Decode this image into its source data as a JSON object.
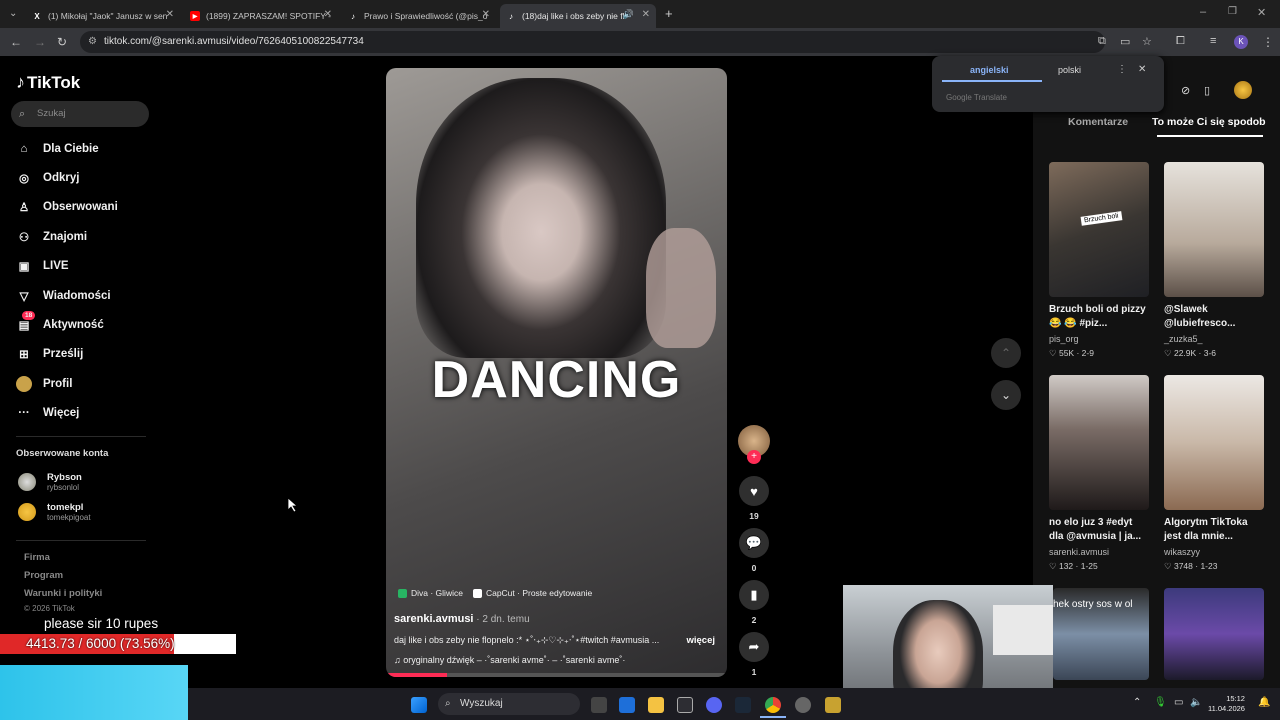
{
  "browser": {
    "tabs": [
      {
        "title": "(1) Mikołaj \"Jaok\" Janusz w sen",
        "icon": "x-icon"
      },
      {
        "title": "(1899) ZAPRASZAM! SPOTIFY -",
        "icon": "youtube-icon"
      },
      {
        "title": "Prawo i Sprawiedliwość (@pis_o",
        "icon": "tiktok-icon"
      },
      {
        "title": "(18)daj like i obs zeby nie fl",
        "icon": "tiktok-icon"
      }
    ],
    "url": "tiktok.com/@sarenki.avmusi/video/7626405100822547734"
  },
  "translate_popup": {
    "lang_from": "angielski",
    "lang_to": "polski",
    "footer": "Google Translate"
  },
  "sidebar": {
    "logo": "TikTok",
    "search_placeholder": "Szukaj",
    "nav": [
      {
        "label": "Dla Ciebie",
        "icon": "home-icon"
      },
      {
        "label": "Odkryj",
        "icon": "compass-icon"
      },
      {
        "label": "Obserwowani",
        "icon": "following-icon"
      },
      {
        "label": "Znajomi",
        "icon": "friends-icon"
      },
      {
        "label": "LIVE",
        "icon": "live-icon"
      },
      {
        "label": "Wiadomości",
        "icon": "messages-icon"
      },
      {
        "label": "Aktywność",
        "icon": "activity-icon",
        "badge": "18"
      },
      {
        "label": "Prześlij",
        "icon": "upload-icon"
      },
      {
        "label": "Profil",
        "icon": "profile-icon"
      },
      {
        "label": "Więcej",
        "icon": "more-icon"
      }
    ],
    "followed_header": "Obserwowane konta",
    "followed": [
      {
        "name": "Rybson",
        "handle": "rybsonlol"
      },
      {
        "name": "tomekpl",
        "handle": "tomekpigoat"
      }
    ],
    "footer": [
      "Firma",
      "Program",
      "Warunki i polityki"
    ],
    "copyright": "© 2026 TikTok"
  },
  "video": {
    "overlay_word": "DANCING",
    "chips": [
      "Diva · Gliwice",
      "CapCut · Proste edytowanie"
    ],
    "author": "sarenki.avmusi",
    "ago": " · 2 dn. temu",
    "description": "daj like i obs zeby nie flopnelo :* ⋆˚‧₊⊹♡⊹₊‧˚⋆#twitch #avmusia ...",
    "more": "więcej",
    "sound": "♫  oryginalny dźwięk – ·˚sarenki avme˚· – ·˚sarenki avme˚·",
    "progress": 0.18
  },
  "actions": {
    "likes": "19",
    "comments": "0",
    "saves": "2",
    "shares": "1"
  },
  "right_panel": {
    "tab_comments": "Komentarze",
    "tab_suggested": "To może Ci się spodob",
    "cards": [
      {
        "title": "Brzuch boli od pizzy 😂 😂 #piz...",
        "user": "pis_org",
        "stats": "♡ 55K · 2-9",
        "img_text": "Brzuch boli"
      },
      {
        "title": "@Slawek @lubiefresco...",
        "user": "_zuzka5_",
        "stats": "♡ 22.9K · 3-6",
        "img_text": ""
      },
      {
        "title": "no elo juz 3 #edyt dla @avmusia | ja...",
        "user": "sarenki.avmusi",
        "stats": "♡ 132 · 1-25",
        "img_text": ""
      },
      {
        "title": "Algorytm TikToka jest dla mnie...",
        "user": "wikaszyy",
        "stats": "♡ 3748 · 1-23",
        "img_text": ""
      }
    ],
    "partial_card_text": "hek ostry sos w ol"
  },
  "stream_overlay": {
    "text": "please sir 10 rupes",
    "progress_text": "4413.73 / 6000 (73.56%)",
    "progress": 0.7356
  },
  "taskbar": {
    "search": "Wyszukaj",
    "time": "15:12",
    "date": "11.04.2026"
  }
}
